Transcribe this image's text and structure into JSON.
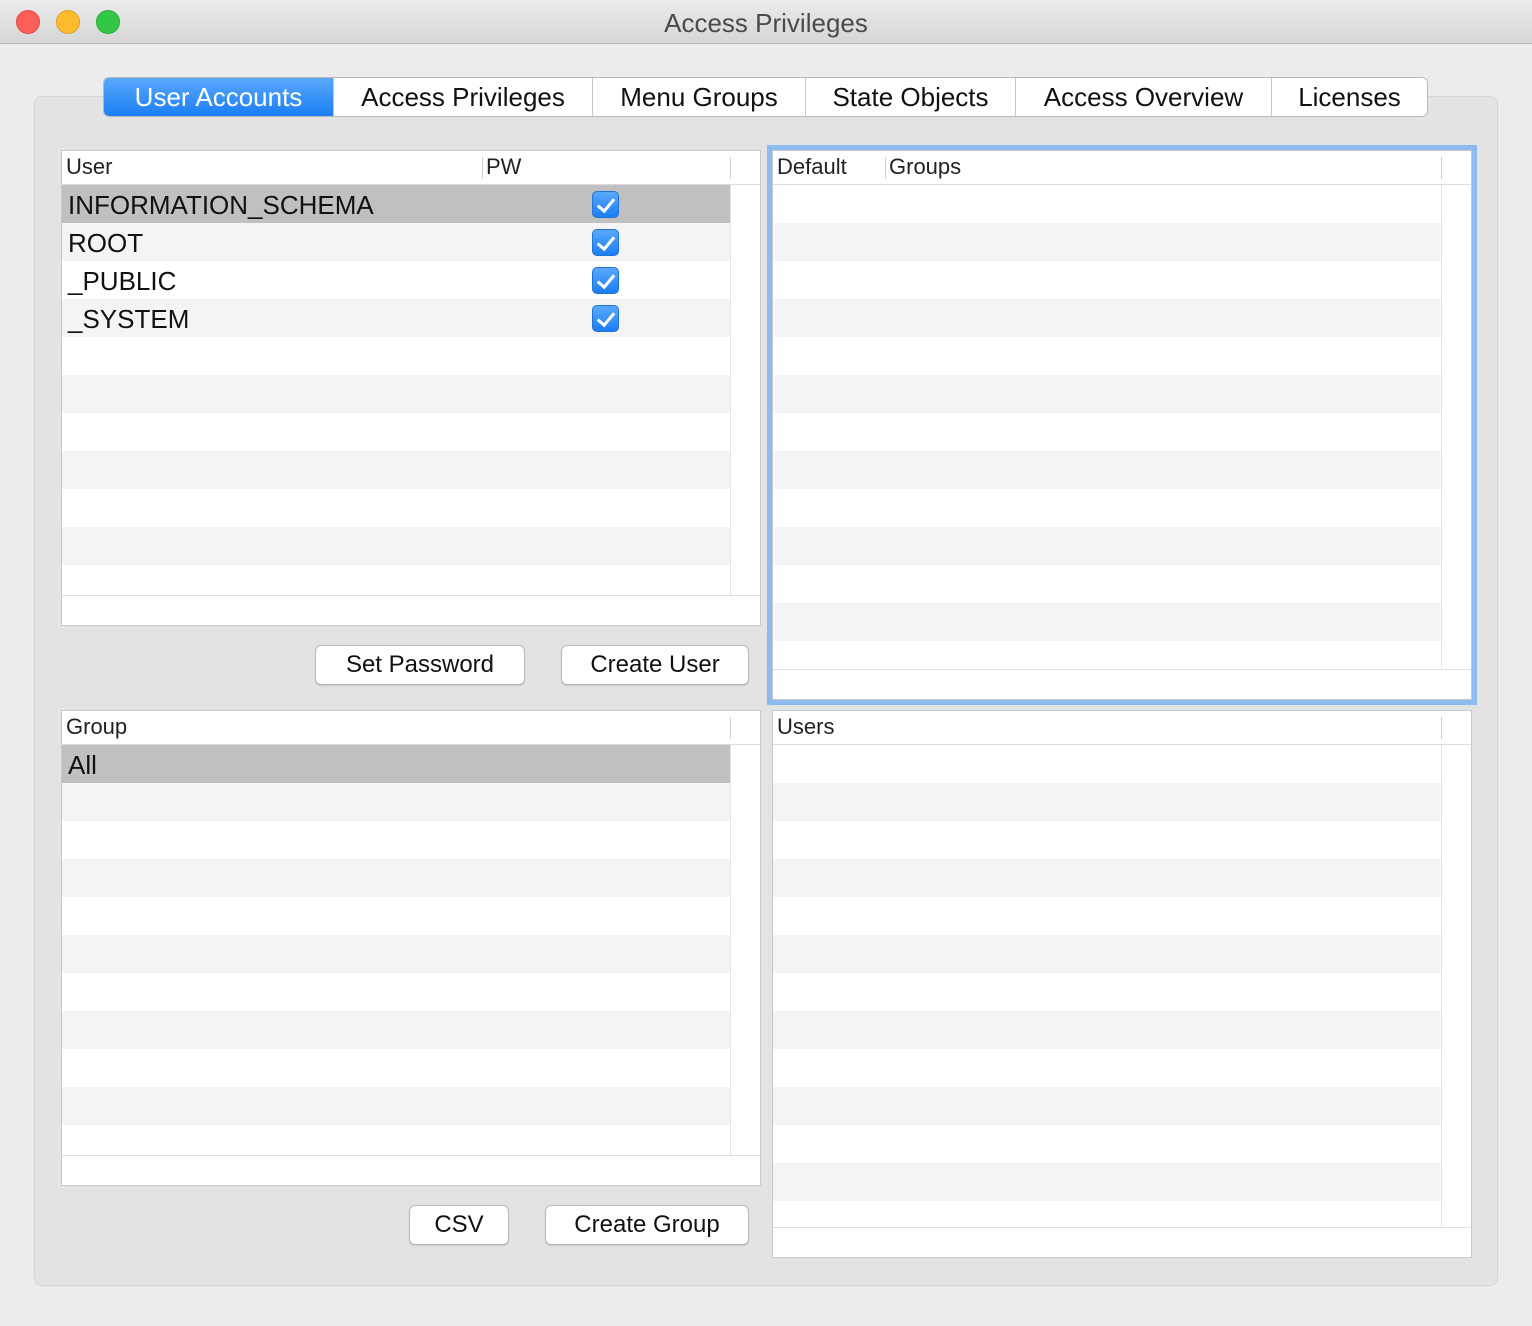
{
  "window": {
    "title": "Access Privileges"
  },
  "tabs": [
    {
      "label": "User Accounts",
      "active": true
    },
    {
      "label": "Access Privileges",
      "active": false
    },
    {
      "label": "Menu Groups",
      "active": false
    },
    {
      "label": "State Objects",
      "active": false
    },
    {
      "label": "Access Overview",
      "active": false
    },
    {
      "label": "Licenses",
      "active": false
    }
  ],
  "users_table": {
    "columns": [
      "User",
      "PW"
    ],
    "rows": [
      {
        "user": "INFORMATION_SCHEMA",
        "pw": true,
        "selected": true
      },
      {
        "user": "ROOT",
        "pw": true,
        "selected": false
      },
      {
        "user": "_PUBLIC",
        "pw": true,
        "selected": false
      },
      {
        "user": "_SYSTEM",
        "pw": true,
        "selected": false
      }
    ]
  },
  "user_groups_table": {
    "columns": [
      "Default",
      "Groups"
    ],
    "rows": []
  },
  "user_buttons": {
    "set_password": "Set Password",
    "create_user": "Create User"
  },
  "groups_table": {
    "columns": [
      "Group"
    ],
    "rows": [
      {
        "group": "All",
        "selected": true
      }
    ]
  },
  "group_users_table": {
    "columns": [
      "Users"
    ],
    "rows": []
  },
  "group_buttons": {
    "csv": "CSV",
    "create_group": "Create Group"
  },
  "colors": {
    "accent": "#1a7ef3",
    "selected_row": "#c0c0c0",
    "focus_ring": "#8dbbef"
  }
}
